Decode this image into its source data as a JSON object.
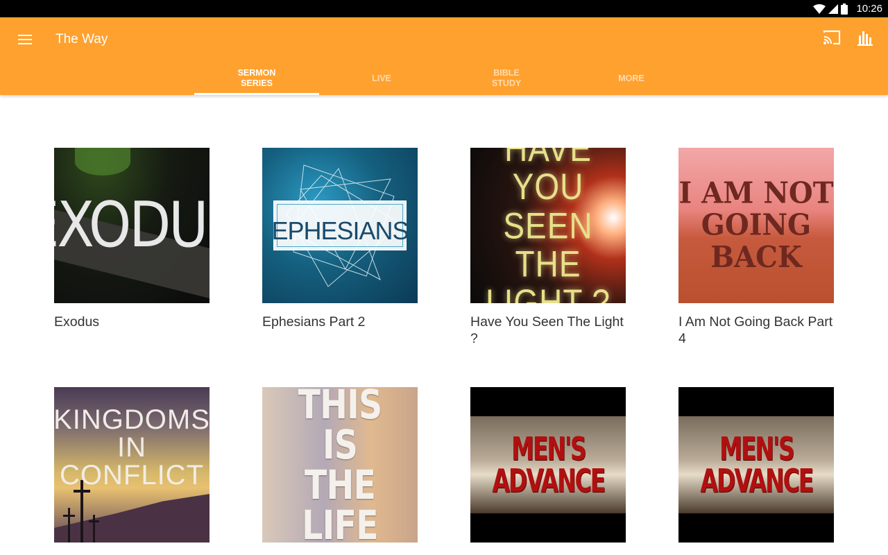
{
  "status_bar": {
    "time": "10:26",
    "icons": [
      "wifi-icon",
      "signal-icon",
      "battery-icon"
    ]
  },
  "app_bar": {
    "title": "The Way",
    "background_color": "#ffa12e",
    "icons": [
      "menu-icon",
      "cast-icon",
      "stats-icon"
    ]
  },
  "tabs": [
    {
      "label": "SERMON\nSERIES",
      "active": true
    },
    {
      "label": "LIVE",
      "active": false
    },
    {
      "label": "BIBLE\nSTUDY",
      "active": false
    },
    {
      "label": "MORE",
      "active": false
    }
  ],
  "series": [
    {
      "title": "Exodus",
      "art_text": "EXODUS"
    },
    {
      "title": "Ephesians Part 2",
      "art_text": "EPHESIANS"
    },
    {
      "title": "Have You Seen The Light ?",
      "art_text": "HAVE YOU\nSEEN THE\nLIGHT ?"
    },
    {
      "title": "I Am Not Going Back Part 4",
      "art_text": "I AM NOT\nGOING\nBACK"
    },
    {
      "title": "",
      "art_text": "KINGDOMS\nIN\nCONFLICT"
    },
    {
      "title": "",
      "art_text": "THIS IS\nTHE LIFE"
    },
    {
      "title": "",
      "art_text": "MEN'S\nADVANCE"
    },
    {
      "title": "",
      "art_text": "MEN'S\nADVANCE"
    }
  ]
}
